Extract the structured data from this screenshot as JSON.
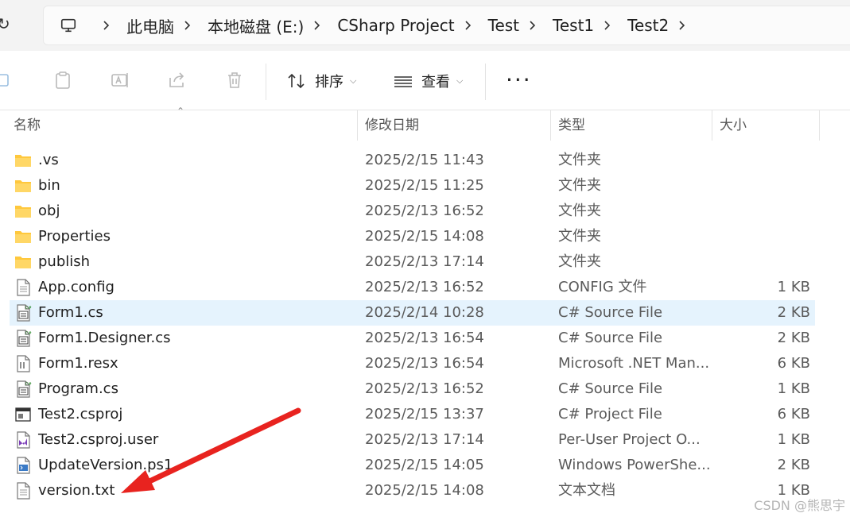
{
  "breadcrumbs": [
    "此电脑",
    "本地磁盘 (E:)",
    "CSharp Project",
    "Test",
    "Test1",
    "Test2"
  ],
  "toolbar": {
    "sort_label": "排序",
    "view_label": "查看",
    "more_label": "···"
  },
  "columns": {
    "name": "名称",
    "date": "修改日期",
    "type": "类型",
    "size": "大小"
  },
  "files": [
    {
      "name": ".vs",
      "date": "2025/2/15 11:43",
      "type": "文件夹",
      "size": "",
      "icon": "folder-icon"
    },
    {
      "name": "bin",
      "date": "2025/2/15 11:25",
      "type": "文件夹",
      "size": "",
      "icon": "folder-icon"
    },
    {
      "name": "obj",
      "date": "2025/2/13 16:52",
      "type": "文件夹",
      "size": "",
      "icon": "folder-icon"
    },
    {
      "name": "Properties",
      "date": "2025/2/15 14:08",
      "type": "文件夹",
      "size": "",
      "icon": "folder-icon"
    },
    {
      "name": "publish",
      "date": "2025/2/13 17:14",
      "type": "文件夹",
      "size": "",
      "icon": "folder-icon"
    },
    {
      "name": "App.config",
      "date": "2025/2/13 16:52",
      "type": "CONFIG 文件",
      "size": "1 KB",
      "icon": "config-file-icon"
    },
    {
      "name": "Form1.cs",
      "date": "2025/2/14 10:28",
      "type": "C# Source File",
      "size": "2 KB",
      "icon": "csharp-file-icon",
      "selected": true
    },
    {
      "name": "Form1.Designer.cs",
      "date": "2025/2/13 16:54",
      "type": "C# Source File",
      "size": "2 KB",
      "icon": "csharp-file-icon"
    },
    {
      "name": "Form1.resx",
      "date": "2025/2/13 16:54",
      "type": "Microsoft .NET Man...",
      "size": "6 KB",
      "icon": "resx-file-icon"
    },
    {
      "name": "Program.cs",
      "date": "2025/2/13 16:52",
      "type": "C# Source File",
      "size": "1 KB",
      "icon": "csharp-file-icon"
    },
    {
      "name": "Test2.csproj",
      "date": "2025/2/15 13:37",
      "type": "C# Project File",
      "size": "6 KB",
      "icon": "csproj-file-icon"
    },
    {
      "name": "Test2.csproj.user",
      "date": "2025/2/13 17:14",
      "type": "Per-User Project O...",
      "size": "1 KB",
      "icon": "visual-studio-file-icon"
    },
    {
      "name": "UpdateVersion.ps1",
      "date": "2025/2/15 14:05",
      "type": "Windows PowerShe...",
      "size": "2 KB",
      "icon": "powershell-file-icon"
    },
    {
      "name": "version.txt",
      "date": "2025/2/15 14:08",
      "type": "文本文档",
      "size": "1 KB",
      "icon": "text-file-icon"
    }
  ],
  "colors": {
    "selection": "#e5f3fd",
    "folder": "#ffc83d",
    "arrow": "#e8231f"
  },
  "watermark": "CSDN @熊思宇"
}
